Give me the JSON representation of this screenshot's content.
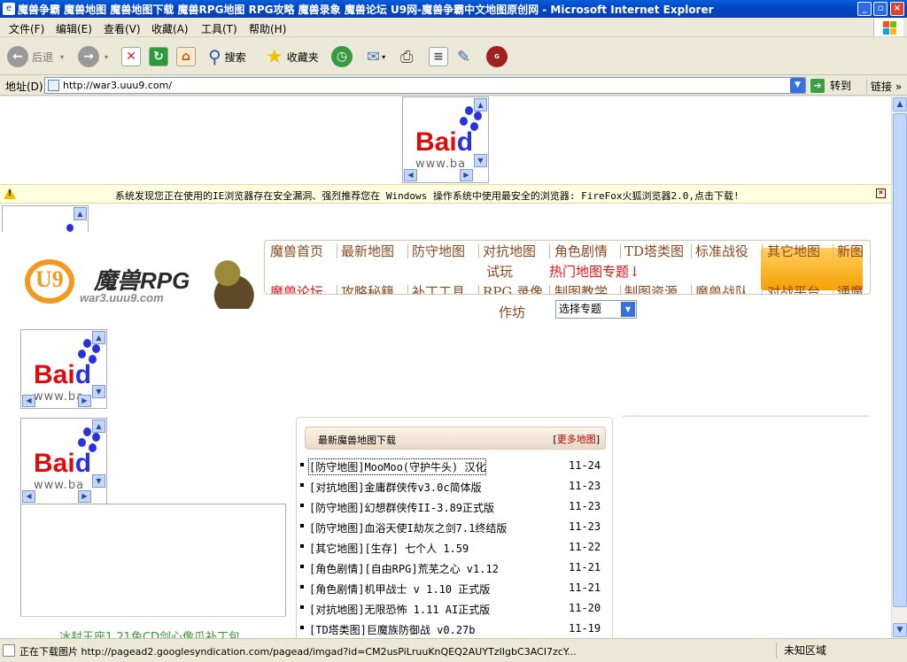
{
  "window": {
    "title": "魔兽争霸 魔兽地图 魔兽地图下载 魔兽RPG地图 RPG攻略 魔兽录象 魔兽论坛 U9网-魔兽争霸中文地图原创网 - Microsoft Internet Explorer",
    "minimize": "_",
    "maximize": "▫",
    "close": "×"
  },
  "menu": [
    "文件(F)",
    "编辑(E)",
    "查看(V)",
    "收藏(A)",
    "工具(T)",
    "帮助(H)"
  ],
  "toolbar": {
    "back": "后退",
    "search": "搜索",
    "favorites": "收藏夹"
  },
  "address": {
    "label": "地址(D)",
    "url": "http://war3.uuu9.com/",
    "go": "转到",
    "links": "链接"
  },
  "infobar": {
    "message": "系统发现您正在使用的IE浏览器存在安全漏洞、强烈推荐您在 Windows 操作系统中使用最安全的浏览器: FireFox火狐浏览器2.0,点击下载!"
  },
  "ads": {
    "baidu_red": "Bai",
    "baidu_blue": "d",
    "baidu_www": "www.ba"
  },
  "site": {
    "logo_mark": "U9",
    "brand": "魔兽RPG",
    "domain": "war3.uuu9.com"
  },
  "nav": {
    "row1": [
      "魔兽首页",
      "最新地图",
      "防守地图",
      "对抗地图",
      "角色剧情",
      "TD塔类图",
      "标准战役",
      "其它地图",
      "新图"
    ],
    "row1b": [
      "试玩",
      "热门地图专题↓"
    ],
    "row2": [
      "魔兽论坛",
      "攻略秘籍",
      "补丁工具",
      "RPG 录像",
      "制图教学",
      "制图资源",
      "魔兽战队",
      "对战平台",
      "通魔"
    ],
    "row3": "作坊",
    "select": "选择专题"
  },
  "maplist": {
    "title": "最新魔兽地图下载",
    "more": "更多地图",
    "items": [
      {
        "text": "[防守地图]MooMoo(守护牛头) 汉化",
        "date": "11-24"
      },
      {
        "text": "[对抗地图]金庸群侠传v3.0c简体版",
        "date": "11-23"
      },
      {
        "text": "[防守地图]幻想群侠传II-3.89正式版",
        "date": "11-23"
      },
      {
        "text": "[防守地图]血浴天使I劫灰之剑7.1终结版",
        "date": "11-23"
      },
      {
        "text": "[其它地图][生存] 七个人 1.59",
        "date": "11-22"
      },
      {
        "text": "[角色剧情][自由RPG]荒芜之心 v1.12",
        "date": "11-21"
      },
      {
        "text": "[角色剧情]机甲战士 v 1.10 正式版",
        "date": "11-21"
      },
      {
        "text": "[对抗地图]无限恐怖 1.11 AI正式版",
        "date": "11-20"
      },
      {
        "text": "[TD塔类图]巨魔族防御战 v0.27b",
        "date": "11-19"
      }
    ]
  },
  "bottom_link": "冰封王座1.21免CD剑心像瓜补丁包",
  "status": {
    "text": "正在下载图片 http://pagead2.googlesyndication.com/pagead/imgad?id=CM2usPiLruuKnQEQ2AUYTzIIgbC3ACI7zcY...",
    "zone": "未知区域"
  },
  "colors": {
    "titlebar": "#0046c8",
    "nav_text": "#8a4a20",
    "nav_hot": "#e81010",
    "infobar": "#ffffe1",
    "link_green": "#3a9a30"
  }
}
